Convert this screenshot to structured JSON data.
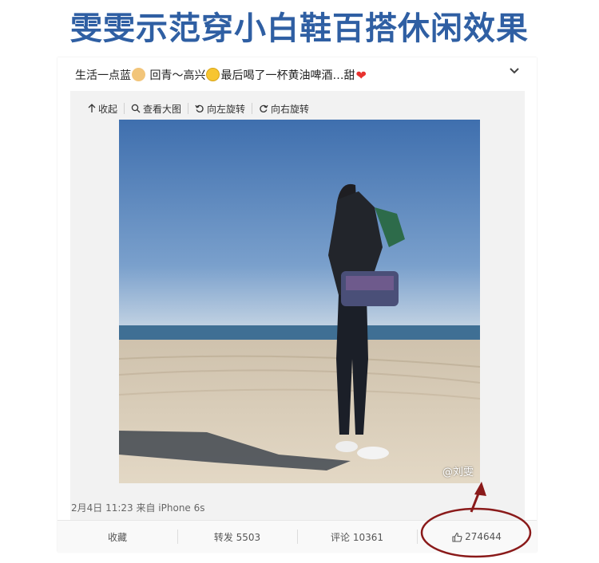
{
  "headline": "雯雯示范穿小白鞋百搭休闲效果",
  "post": {
    "text_1": "生活一点蓝",
    "text_2": " 回青～高兴",
    "text_3": "最后喝了一杯黄油啤酒…甜",
    "icons": [
      "victory-hand-emoji",
      "smile-emoji",
      "heart-emoji"
    ]
  },
  "toolbar": {
    "collapse": "收起",
    "view_large": "查看大图",
    "rotate_left": "向左旋转",
    "rotate_right": "向右旋转"
  },
  "photo": {
    "watermark": "@刘雯"
  },
  "meta": "2月4日 11:23 来自 iPhone 6s",
  "actions": {
    "favorite": "收藏",
    "repost": "转发 5503",
    "comment": "评论 10361",
    "like_count": "274644"
  },
  "colors": {
    "headline": "#2f5fa3",
    "annotation": "#8a1a1a"
  }
}
